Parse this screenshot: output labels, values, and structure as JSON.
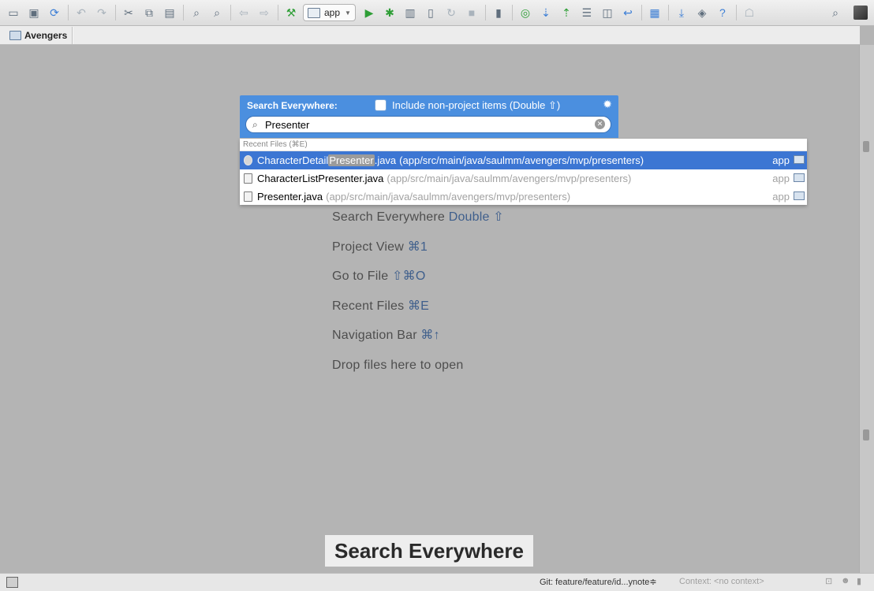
{
  "toolbar": {
    "run_config": "app"
  },
  "navbar": {
    "breadcrumb": "Avengers"
  },
  "popup": {
    "title": "Search Everywhere:",
    "include_label": "Include non-project items (Double ⇧)",
    "query": "Presenter",
    "section_header": "Recent Files (⌘E)",
    "results": [
      {
        "name_prefix": "CharacterDetail",
        "name_match": "Presenter",
        "name_suffix": ".java",
        "path": "(app/src/main/java/saulmm/avengers/mvp/presenters)",
        "module": "app"
      },
      {
        "name": "CharacterListPresenter.java",
        "path": "(app/src/main/java/saulmm/avengers/mvp/presenters)",
        "module": "app"
      },
      {
        "name": "Presenter.java",
        "path": "(app/src/main/java/saulmm/avengers/mvp/presenters)",
        "module": "app"
      }
    ]
  },
  "hints": [
    {
      "label": "Search Everywhere",
      "key": "Double ⇧"
    },
    {
      "label": "Project View",
      "key": "⌘1"
    },
    {
      "label": "Go to File",
      "key": "⇧⌘O"
    },
    {
      "label": "Recent Files",
      "key": "⌘E"
    },
    {
      "label": "Navigation Bar",
      "key": "⌘↑"
    },
    {
      "label": "Drop files here to open",
      "key": ""
    }
  ],
  "caption": "Search Everywhere",
  "status": {
    "git": "Git: feature/feature/id...ynote≑",
    "context": "Context: <no context>"
  }
}
